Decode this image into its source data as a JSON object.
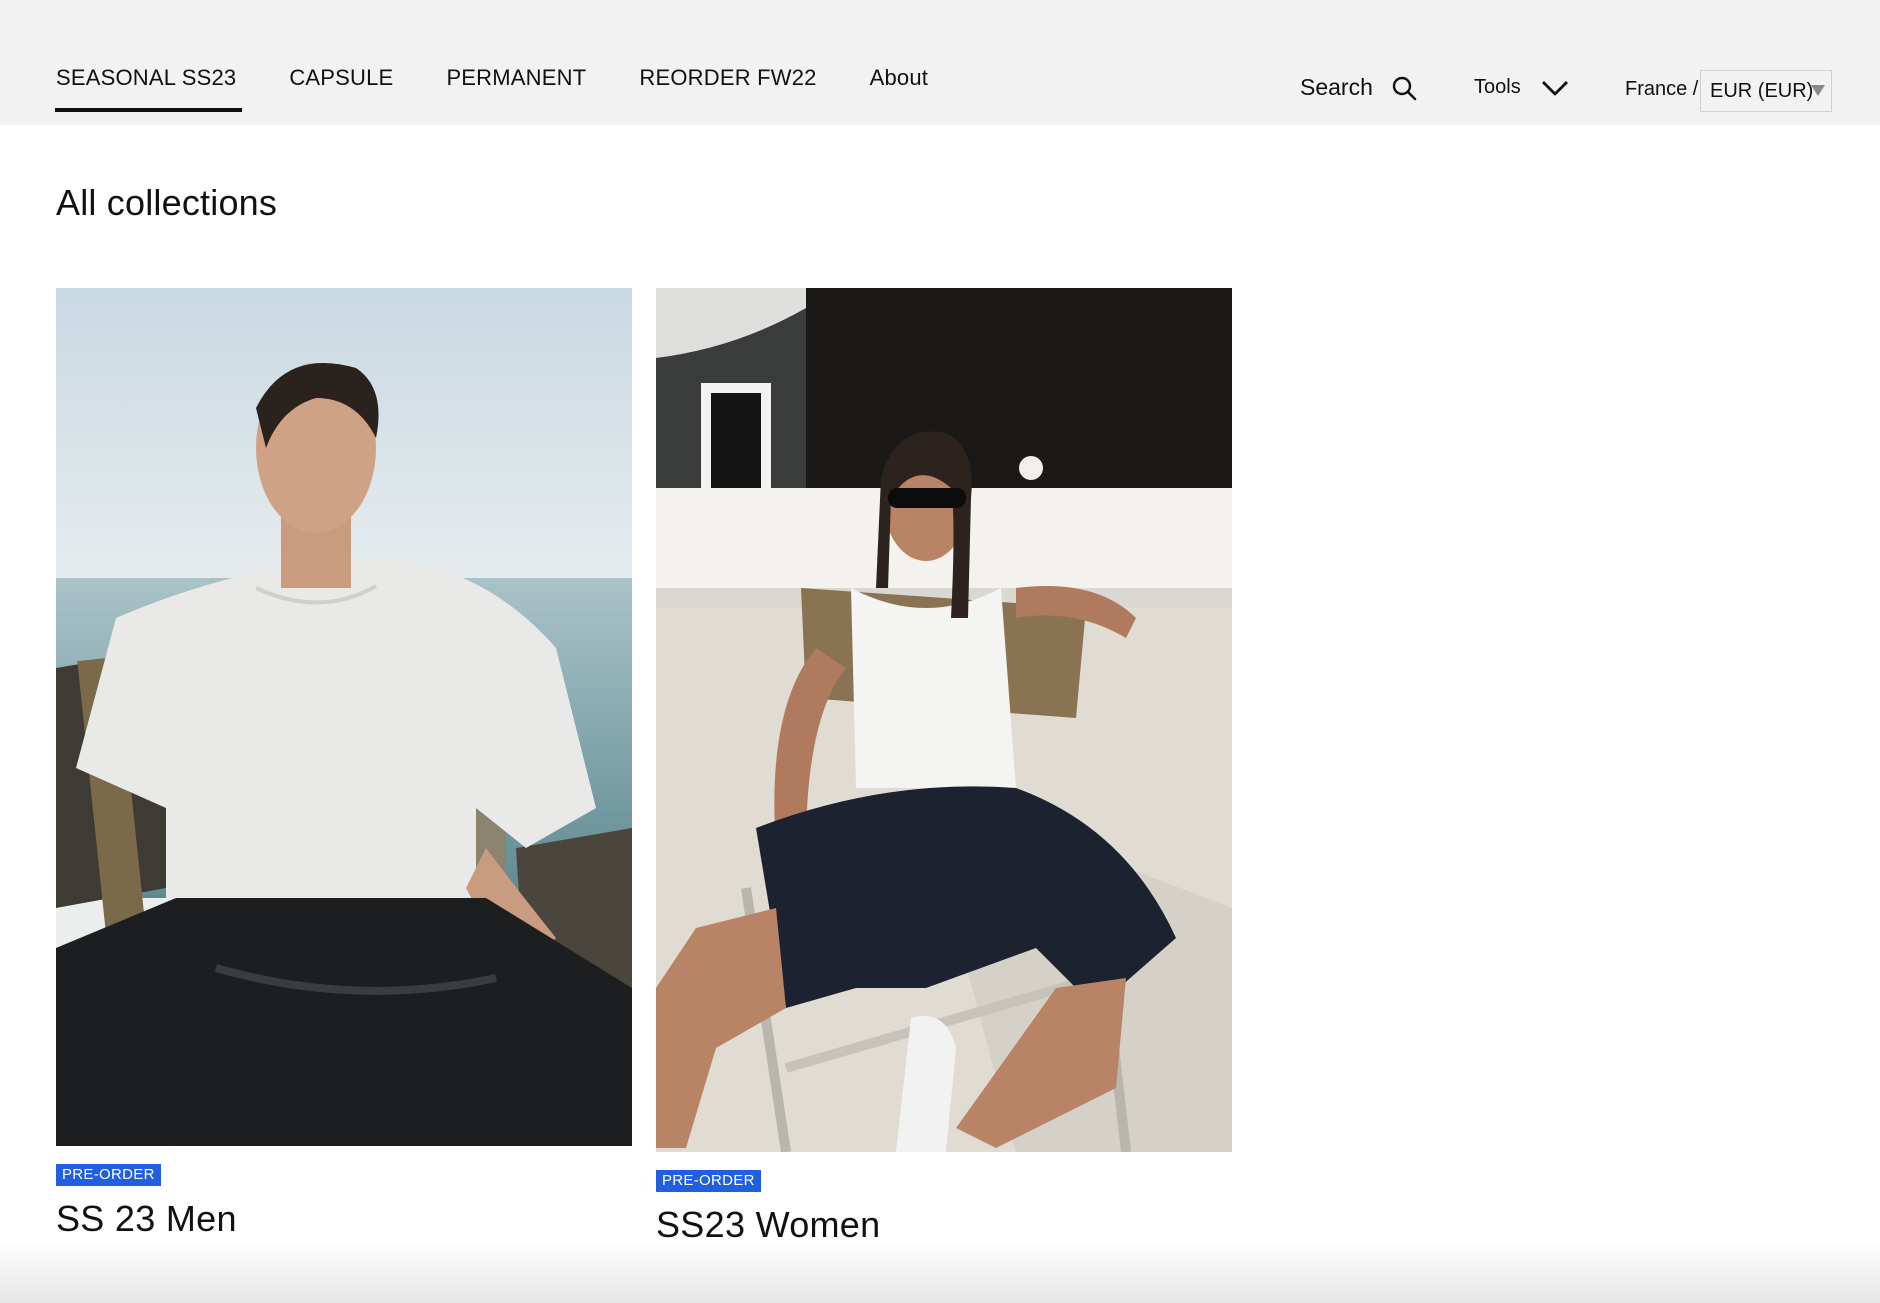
{
  "nav": {
    "tabs": [
      {
        "label": "SEASONAL SS23",
        "active": true
      },
      {
        "label": "CAPSULE",
        "active": false
      },
      {
        "label": "PERMANENT",
        "active": false
      },
      {
        "label": "REORDER FW22",
        "active": false
      },
      {
        "label": "About",
        "active": false
      }
    ]
  },
  "header": {
    "search_label": "Search",
    "search_icon": "search-icon",
    "tools_label": "Tools",
    "tools_icon": "chevron-down-icon",
    "country": "France /",
    "currency": "EUR (EUR)"
  },
  "main": {
    "title": "All collections",
    "collections": [
      {
        "badge": "PRE-ORDER",
        "title": "SS 23 Men",
        "image": "man in white t-shirt seated on chair by the sea"
      },
      {
        "badge": "PRE-ORDER",
        "title": "SS23 Women",
        "image": "woman in sunglasses and white tank top seated on chair on terrace"
      }
    ]
  },
  "colors": {
    "header_bg": "#f2f2f2",
    "badge": "#1f5fe0",
    "text": "#111111"
  }
}
